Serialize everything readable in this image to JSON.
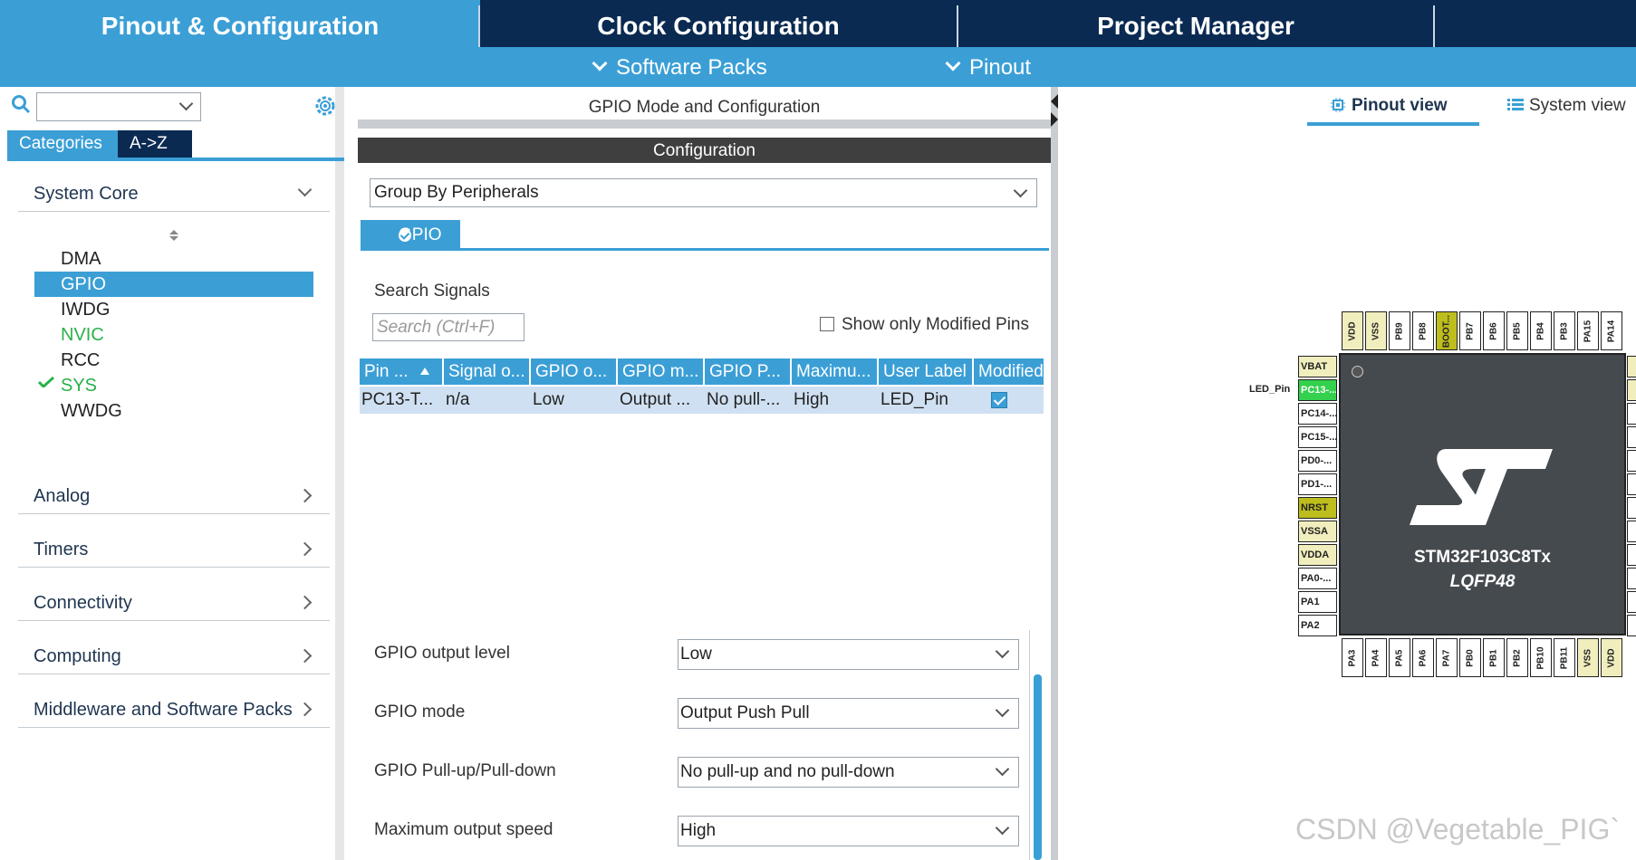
{
  "tabs": {
    "pinout": "Pinout & Configuration",
    "clock": "Clock Configuration",
    "project": "Project Manager"
  },
  "subbar": {
    "software_packs": "Software Packs",
    "pinout": "Pinout"
  },
  "left": {
    "categories_tab": "Categories",
    "az_tab": "A->Z",
    "categories": [
      "System Core",
      "Analog",
      "Timers",
      "Connectivity",
      "Computing",
      "Middleware and Software Packs"
    ],
    "system_core_items": [
      "DMA",
      "GPIO",
      "IWDG",
      "NVIC",
      "RCC",
      "SYS",
      "WWDG"
    ]
  },
  "middle": {
    "header": "GPIO Mode and Configuration",
    "config_bar": "Configuration",
    "group_select": "Group By Peripherals",
    "gpio_tab": "GPIO",
    "search_label": "Search Signals",
    "search_placeholder": "Search (Ctrl+F)",
    "show_modified": "Show only Modified Pins",
    "table": {
      "headers": [
        "Pin ...",
        "Signal o...",
        "GPIO o...",
        "GPIO m...",
        "GPIO P...",
        "Maximu...",
        "User Label",
        "Modified"
      ],
      "row": [
        "PC13-T...",
        "n/a",
        "Low",
        "Output ...",
        "No pull-...",
        "High",
        "LED_Pin",
        "true"
      ]
    },
    "properties": [
      {
        "label": "GPIO output level",
        "value": "Low"
      },
      {
        "label": "GPIO mode",
        "value": "Output Push Pull"
      },
      {
        "label": "GPIO Pull-up/Pull-down",
        "value": "No pull-up and no pull-down"
      },
      {
        "label": "Maximum output speed",
        "value": "High"
      }
    ]
  },
  "right": {
    "pinout_view": "Pinout view",
    "system_view": "System view",
    "chip_name": "STM32F103C8Tx",
    "chip_package": "LQFP48",
    "pin_label": "LED_Pin",
    "top_pins": [
      "VDD",
      "VSS",
      "PB9",
      "PB8",
      "BOOT...",
      "PB7",
      "PB6",
      "PB5",
      "PB4",
      "PB3",
      "PA15",
      "PA14"
    ],
    "bottom_pins": [
      "PA3",
      "PA4",
      "PA5",
      "PA6",
      "PA7",
      "PB0",
      "PB1",
      "PB2",
      "PB10",
      "PB11",
      "VSS",
      "VDD"
    ],
    "left_pins": [
      "VBAT",
      "PC13-...",
      "PC14-...",
      "PC15-...",
      "PD0-...",
      "PD1-...",
      "NRST",
      "VSSA",
      "VDDA",
      "PA0-...",
      "PA1",
      "PA2"
    ],
    "watermark": "CSDN @Vegetable_PIG`"
  },
  "colors": {
    "accent": "#3b9fd6",
    "navy": "#0a2a52",
    "pin_green": "#33d14d",
    "pin_yellow": "#f0eebd",
    "pin_olive": "#bdbd1d"
  }
}
